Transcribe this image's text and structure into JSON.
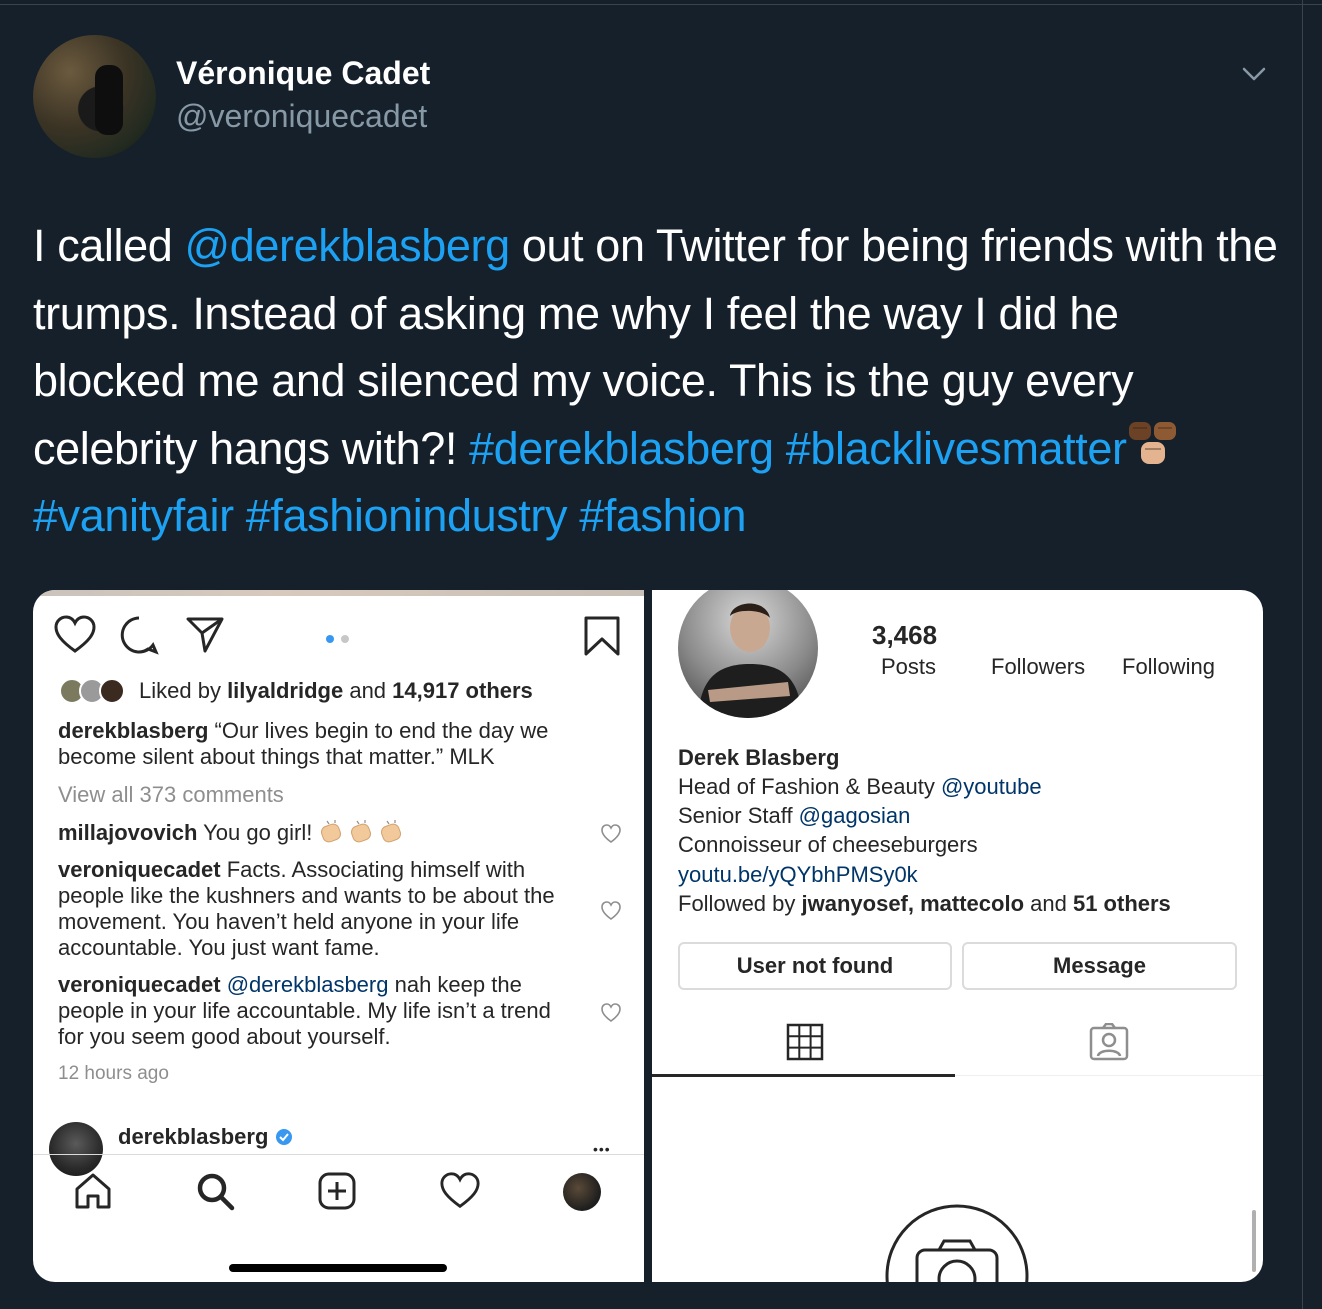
{
  "tweet": {
    "author_name": "Véronique Cadet",
    "author_handle": "@veroniquecadet",
    "text_1": "I called ",
    "mention": "@derekblasberg",
    "text_2": " out on Twitter for being friends with the trumps. Instead of asking me why I feel the way I did he blocked me and silenced my voice. This is the guy every celebrity hangs with?!  ",
    "hashtags_line1": "#derekblasberg #blacklivesmatter",
    "hashtags_line2": "#vanityfair #fashionindustry #fashion",
    "emoji_name": "raised-fists-emoji"
  },
  "left_post": {
    "liked_by_prefix": "Liked by ",
    "liked_by_user": "lilyaldridge",
    "liked_by_and": " and ",
    "liked_by_count": "14,917 others",
    "caption_user": "derekblasberg",
    "caption_text": " “Our lives begin to end the day we become silent about things that matter.” MLK",
    "view_comments": "View all 373 comments",
    "comments": [
      {
        "user": "millajovovich",
        "text": " You go girl!"
      },
      {
        "user": "veroniquecadet",
        "text": " Facts. Associating himself with people like the kushners and wants to be about the movement. You haven’t held anyone in your life accountable. You just want fame."
      },
      {
        "user": "veroniquecadet",
        "mention": " @derekblasberg",
        "text": " nah keep the people in your life accountable. My life isn’t a trend for you seem good about yourself."
      }
    ],
    "timestamp": "12 hours ago",
    "next_post_user": "derekblasberg",
    "more": "•••"
  },
  "right_profile": {
    "posts_count": "3,468",
    "posts_label": "Posts",
    "followers_label": "Followers",
    "following_label": "Following",
    "full_name": "Derek Blasberg",
    "bio_line1": "Head of Fashion & Beauty ",
    "bio_mention1": "@youtube",
    "bio_line2": "Senior Staff ",
    "bio_mention2": "@gagosian",
    "bio_line3": "Connoisseur of cheeseburgers",
    "bio_link": "youtu.be/yQYbhPMSy0k",
    "followed_prefix": "Followed by ",
    "followed_users": "jwanyosef, mattecolo",
    "followed_and": " and ",
    "followed_others": "51 others",
    "button_left": "User not found",
    "button_right": "Message"
  },
  "colors": {
    "background": "#15202b",
    "link_blue": "#1da1f2",
    "muted_gray": "#8899a6",
    "ig_link": "#003569"
  }
}
